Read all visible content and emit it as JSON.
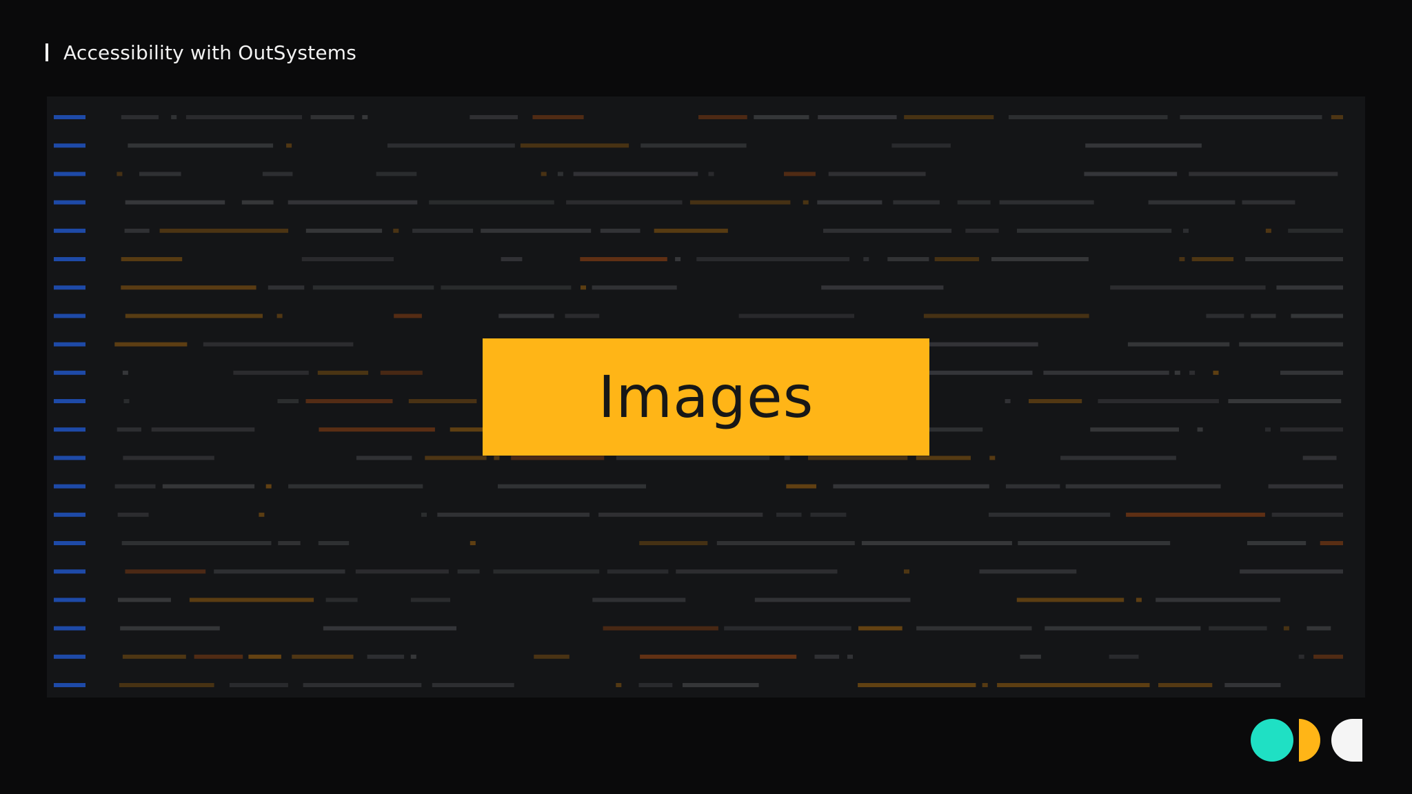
{
  "header": {
    "title": "Accessibility with OutSystems"
  },
  "slide": {
    "title": "Images"
  },
  "colors": {
    "background": "#0a0a0b",
    "panel": "#141517",
    "accent_yellow": "#ffb517",
    "logo_teal": "#1fe0c4",
    "logo_yellow": "#ffb517",
    "logo_white": "#f5f5f5",
    "code_blue": "#1e4aa8",
    "code_gray": "#3a3b3e",
    "code_orange": "#6e4812",
    "code_rust": "#6a3414"
  },
  "logo": {
    "icons": [
      "circle-icon",
      "half-circle-icon",
      "crescent-icon"
    ]
  }
}
